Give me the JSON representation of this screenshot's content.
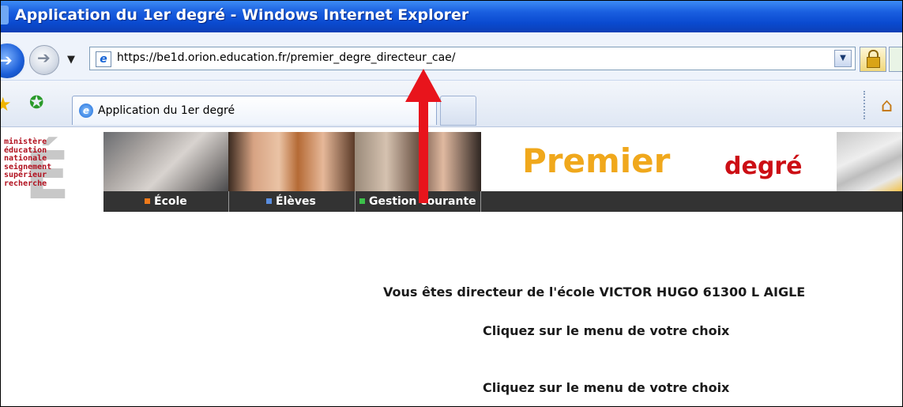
{
  "window": {
    "title": "Application du 1er degré - Windows Internet Explorer"
  },
  "address_bar": {
    "url": "https://be1d.orion.education.fr/premier_degre_directeur_cae/"
  },
  "tabs": [
    {
      "label": "Application du 1er degré",
      "active": true
    }
  ],
  "banner": {
    "logo_lines": [
      "ministère",
      "éducation",
      "nationale",
      "seignement",
      "supérieur",
      "recherche"
    ],
    "logo_letter": "É",
    "title_main": "Premier",
    "title_sub": "degré",
    "menu": [
      {
        "label": "École",
        "marker_color": "#f07a1a"
      },
      {
        "label": "Élèves",
        "marker_color": "#5a8ee0"
      },
      {
        "label": "Gestion courante",
        "marker_color": "#3cc04a"
      }
    ]
  },
  "content": {
    "director_line": "Vous êtes directeur de l'école VICTOR HUGO 61300 L AIGLE",
    "instruction_1": "Cliquez sur le menu de votre choix",
    "instruction_2": "Cliquez sur le menu de votre choix"
  },
  "colors": {
    "premier": "#f0a81c",
    "degre": "#cc0e15",
    "annotation_arrow": "#e8141c",
    "menubar": "#333333"
  }
}
